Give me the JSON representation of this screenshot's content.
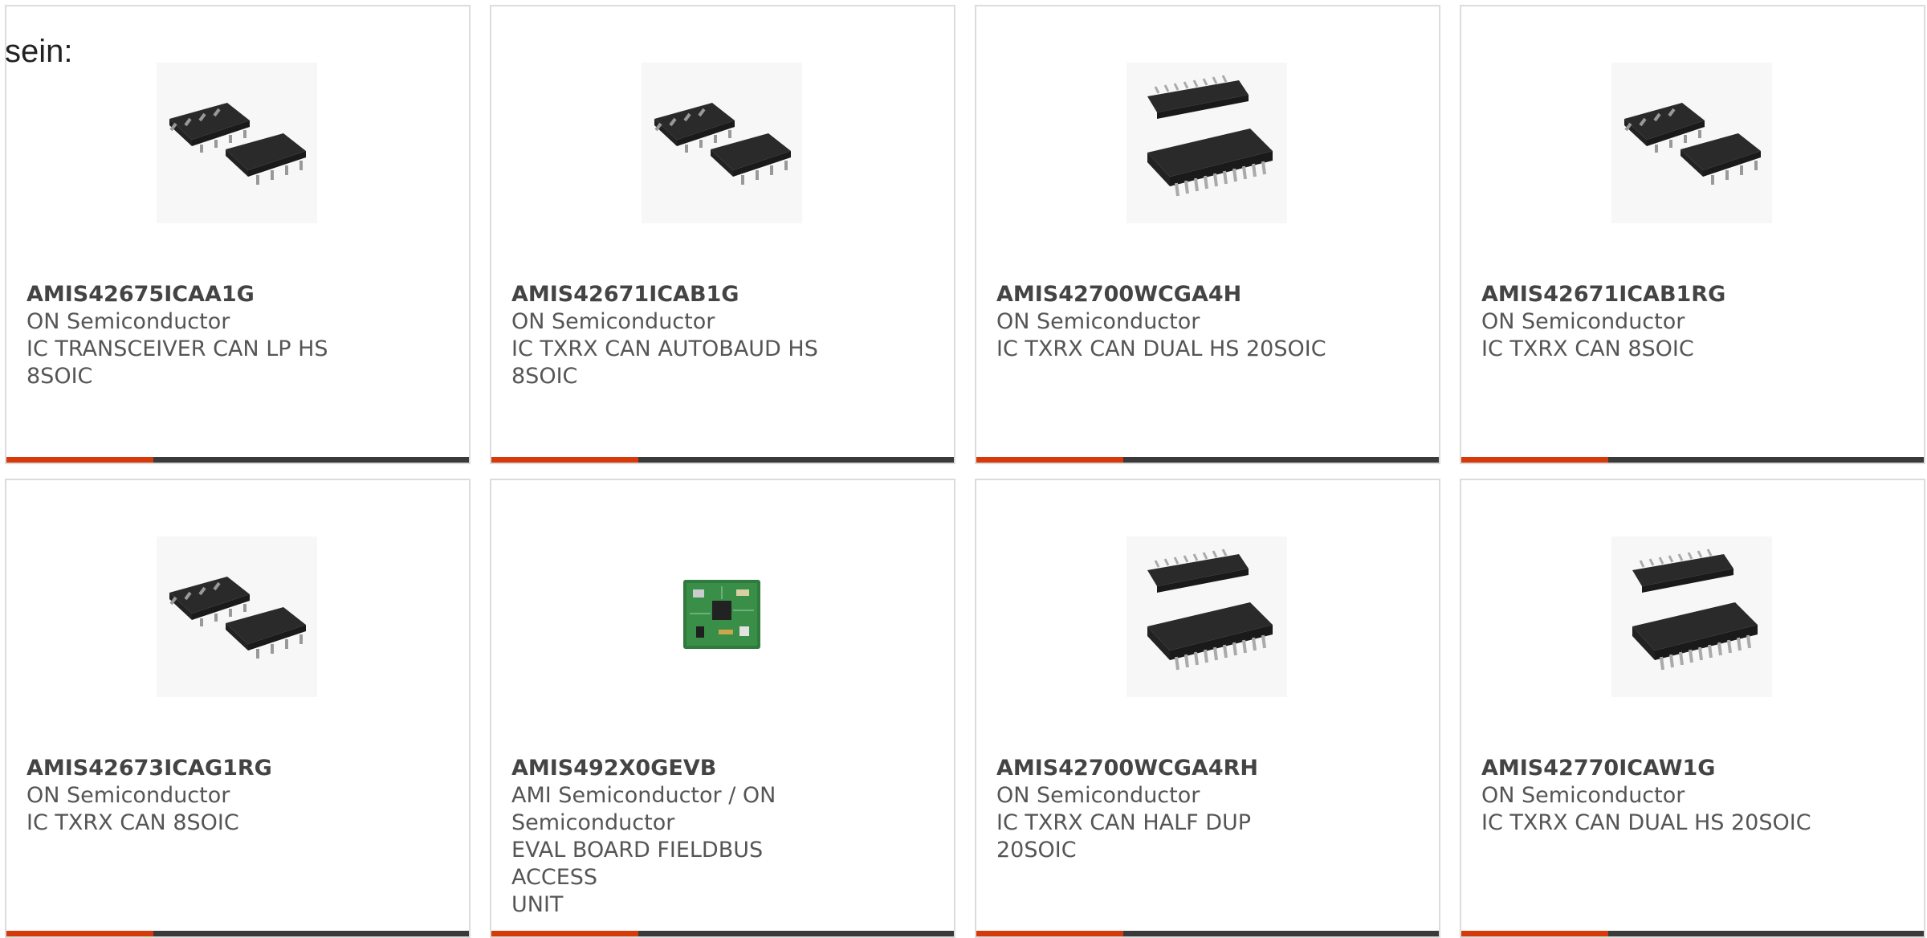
{
  "intro_text": "sein:",
  "colors": {
    "accent": "#d63a0a",
    "dark_bar": "#3a3a3a",
    "border": "#dcdcdc",
    "text": "#555555"
  },
  "products": [
    {
      "part": "AMIS42675ICAA1G",
      "manufacturer": "ON Semiconductor",
      "description": "IC TRANSCEIVER CAN LP HS",
      "description2": "8SOIC",
      "image": "soic-8-chip-image"
    },
    {
      "part": "AMIS42671ICAB1G",
      "manufacturer": "ON Semiconductor",
      "description": "IC TXRX CAN AUTOBAUD HS",
      "description2": "8SOIC",
      "image": "soic-8-chip-image"
    },
    {
      "part": "AMIS42700WCGA4H",
      "manufacturer": "ON Semiconductor",
      "description": "IC TXRX CAN DUAL HS 20SOIC",
      "description2": "",
      "image": "soic-20-chip-image"
    },
    {
      "part": "AMIS42671ICAB1RG",
      "manufacturer": "ON Semiconductor",
      "description": "IC TXRX CAN 8SOIC",
      "description2": "",
      "image": "soic-8-chip-image"
    },
    {
      "part": "AMIS42673ICAG1RG",
      "manufacturer": "ON Semiconductor",
      "description": "IC TXRX CAN 8SOIC",
      "description2": "",
      "image": "soic-8-chip-image"
    },
    {
      "part": "AMIS492X0GEVB",
      "manufacturer": "AMI Semiconductor / ON",
      "manufacturer2": "Semiconductor",
      "description": "EVAL BOARD FIELDBUS ACCESS",
      "description2": "UNIT",
      "image": "eval-board-image"
    },
    {
      "part": "AMIS42700WCGA4RH",
      "manufacturer": "ON Semiconductor",
      "description": "IC TXRX CAN HALF DUP 20SOIC",
      "description2": "",
      "image": "soic-20-chip-image"
    },
    {
      "part": "AMIS42770ICAW1G",
      "manufacturer": "ON Semiconductor",
      "description": "IC TXRX CAN DUAL HS 20SOIC",
      "description2": "",
      "image": "soic-20-chip-image"
    }
  ]
}
